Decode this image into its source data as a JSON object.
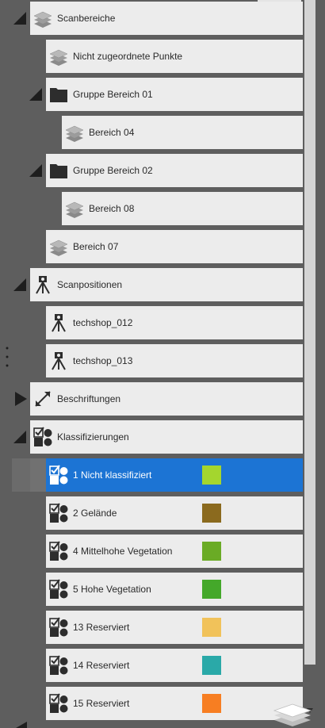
{
  "tree": {
    "items": [
      {
        "label": "Scanbereiche",
        "icon": "layers-icon",
        "expanded": true
      },
      {
        "label": "Nicht zugeordnete Punkte",
        "icon": "layers-icon"
      },
      {
        "label": "Gruppe Bereich 01",
        "icon": "folder-icon",
        "expanded": true
      },
      {
        "label": "Bereich 04",
        "icon": "layers-icon"
      },
      {
        "label": "Gruppe Bereich 02",
        "icon": "folder-icon",
        "expanded": true
      },
      {
        "label": "Bereich 08",
        "icon": "layers-icon"
      },
      {
        "label": "Bereich 07",
        "icon": "layers-icon"
      },
      {
        "label": "Scanpositionen",
        "icon": "scanner-tripod-icon",
        "expanded": true
      },
      {
        "label": "techshop_012",
        "icon": "scanner-tripod-icon"
      },
      {
        "label": "techshop_013",
        "icon": "scanner-tripod-icon"
      },
      {
        "label": "Beschriftungen",
        "icon": "measure-arrow-icon",
        "expanded": false
      },
      {
        "label": "Klassifizierungen",
        "icon": "classification-icon",
        "expanded": true
      },
      {
        "label": "1 Nicht klassifiziert",
        "icon": "classification-icon",
        "color": "#a4d62e",
        "selected": true
      },
      {
        "label": "2 Gelände",
        "icon": "classification-icon",
        "color": "#8b6a1e"
      },
      {
        "label": "4 Mittelhohe Vegetation",
        "icon": "classification-icon",
        "color": "#6aab25"
      },
      {
        "label": "5 Hohe Vegetation",
        "icon": "classification-icon",
        "color": "#44a82a"
      },
      {
        "label": "13 Reserviert",
        "icon": "classification-icon",
        "color": "#f1c25a"
      },
      {
        "label": "14 Reserviert",
        "icon": "classification-icon",
        "color": "#2aa9a8"
      },
      {
        "label": "15 Reserviert",
        "icon": "classification-icon",
        "color": "#f77e22"
      }
    ]
  },
  "colors": {
    "selection": "#1c74d4",
    "row_background": "#ececec",
    "panel_background": "#5e5e5e"
  }
}
